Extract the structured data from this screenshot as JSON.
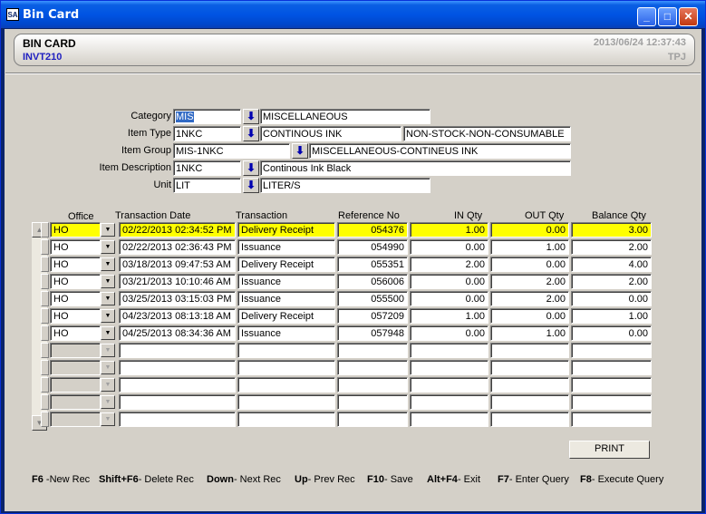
{
  "window": {
    "title": "Bin Card",
    "icon_text": "SA"
  },
  "header": {
    "title": "BIN CARD",
    "code": "INVT210",
    "datetime": "2013/06/24 12:37:43",
    "user": "TPJ"
  },
  "form": {
    "category": {
      "label": "Category",
      "code": "MIS",
      "desc": "MISCELLANEOUS"
    },
    "item_type": {
      "label": "Item Type",
      "code": "1NKC",
      "desc": "CONTINOUS INK",
      "class": "NON-STOCK-NON-CONSUMABLE"
    },
    "item_group": {
      "label": "Item Group",
      "code": "MIS-1NKC",
      "desc": "MISCELLANEOUS-CONTINEUS INK"
    },
    "item_description": {
      "label": "Item Description",
      "code": "1NKC",
      "desc": "Continous Ink Black"
    },
    "unit": {
      "label": "Unit",
      "code": "LIT",
      "desc": "LITER/S"
    }
  },
  "grid": {
    "headers": {
      "office": "Office",
      "date": "Transaction  Date",
      "transaction": "Transaction",
      "reference": "Reference No",
      "in_qty": "IN Qty",
      "out_qty": "OUT Qty",
      "balance": "Balance Qty"
    },
    "rows": [
      {
        "office": "HO",
        "date": "02/22/2013 02:34:52 PM",
        "transaction": "Delivery Receipt",
        "reference": "054376",
        "in_qty": "1.00",
        "out_qty": "0.00",
        "balance": "3.00"
      },
      {
        "office": "HO",
        "date": "02/22/2013 02:36:43 PM",
        "transaction": "Issuance",
        "reference": "054990",
        "in_qty": "0.00",
        "out_qty": "1.00",
        "balance": "2.00"
      },
      {
        "office": "HO",
        "date": "03/18/2013 09:47:53 AM",
        "transaction": "Delivery Receipt",
        "reference": "055351",
        "in_qty": "2.00",
        "out_qty": "0.00",
        "balance": "4.00"
      },
      {
        "office": "HO",
        "date": "03/21/2013 10:10:46 AM",
        "transaction": "Issuance",
        "reference": "056006",
        "in_qty": "0.00",
        "out_qty": "2.00",
        "balance": "2.00"
      },
      {
        "office": "HO",
        "date": "03/25/2013 03:15:03 PM",
        "transaction": "Issuance",
        "reference": "055500",
        "in_qty": "0.00",
        "out_qty": "2.00",
        "balance": "0.00"
      },
      {
        "office": "HO",
        "date": "04/23/2013 08:13:18 AM",
        "transaction": "Delivery Receipt",
        "reference": "057209",
        "in_qty": "1.00",
        "out_qty": "0.00",
        "balance": "1.00"
      },
      {
        "office": "HO",
        "date": "04/25/2013 08:34:36 AM",
        "transaction": "Issuance",
        "reference": "057948",
        "in_qty": "0.00",
        "out_qty": "1.00",
        "balance": "0.00"
      }
    ],
    "empty_rows": 5
  },
  "buttons": {
    "print": "PRINT"
  },
  "shortcuts": [
    {
      "key": "F6",
      "action": " -New Rec"
    },
    {
      "key": "Shift+F6",
      "action": "- Delete Rec"
    },
    {
      "key": "Down",
      "action": "- Next Rec"
    },
    {
      "key": "Up",
      "action": "- Prev Rec"
    },
    {
      "key": "F10",
      "action": "- Save"
    },
    {
      "key": "Alt+F4",
      "action": "- Exit"
    },
    {
      "key": "F7",
      "action": "- Enter Query"
    },
    {
      "key": "F8",
      "action": "- Execute Query"
    }
  ],
  "colors": {
    "current_row": "#ffff00",
    "title_bar": "#0054e3",
    "header_code": "#2020c0"
  }
}
